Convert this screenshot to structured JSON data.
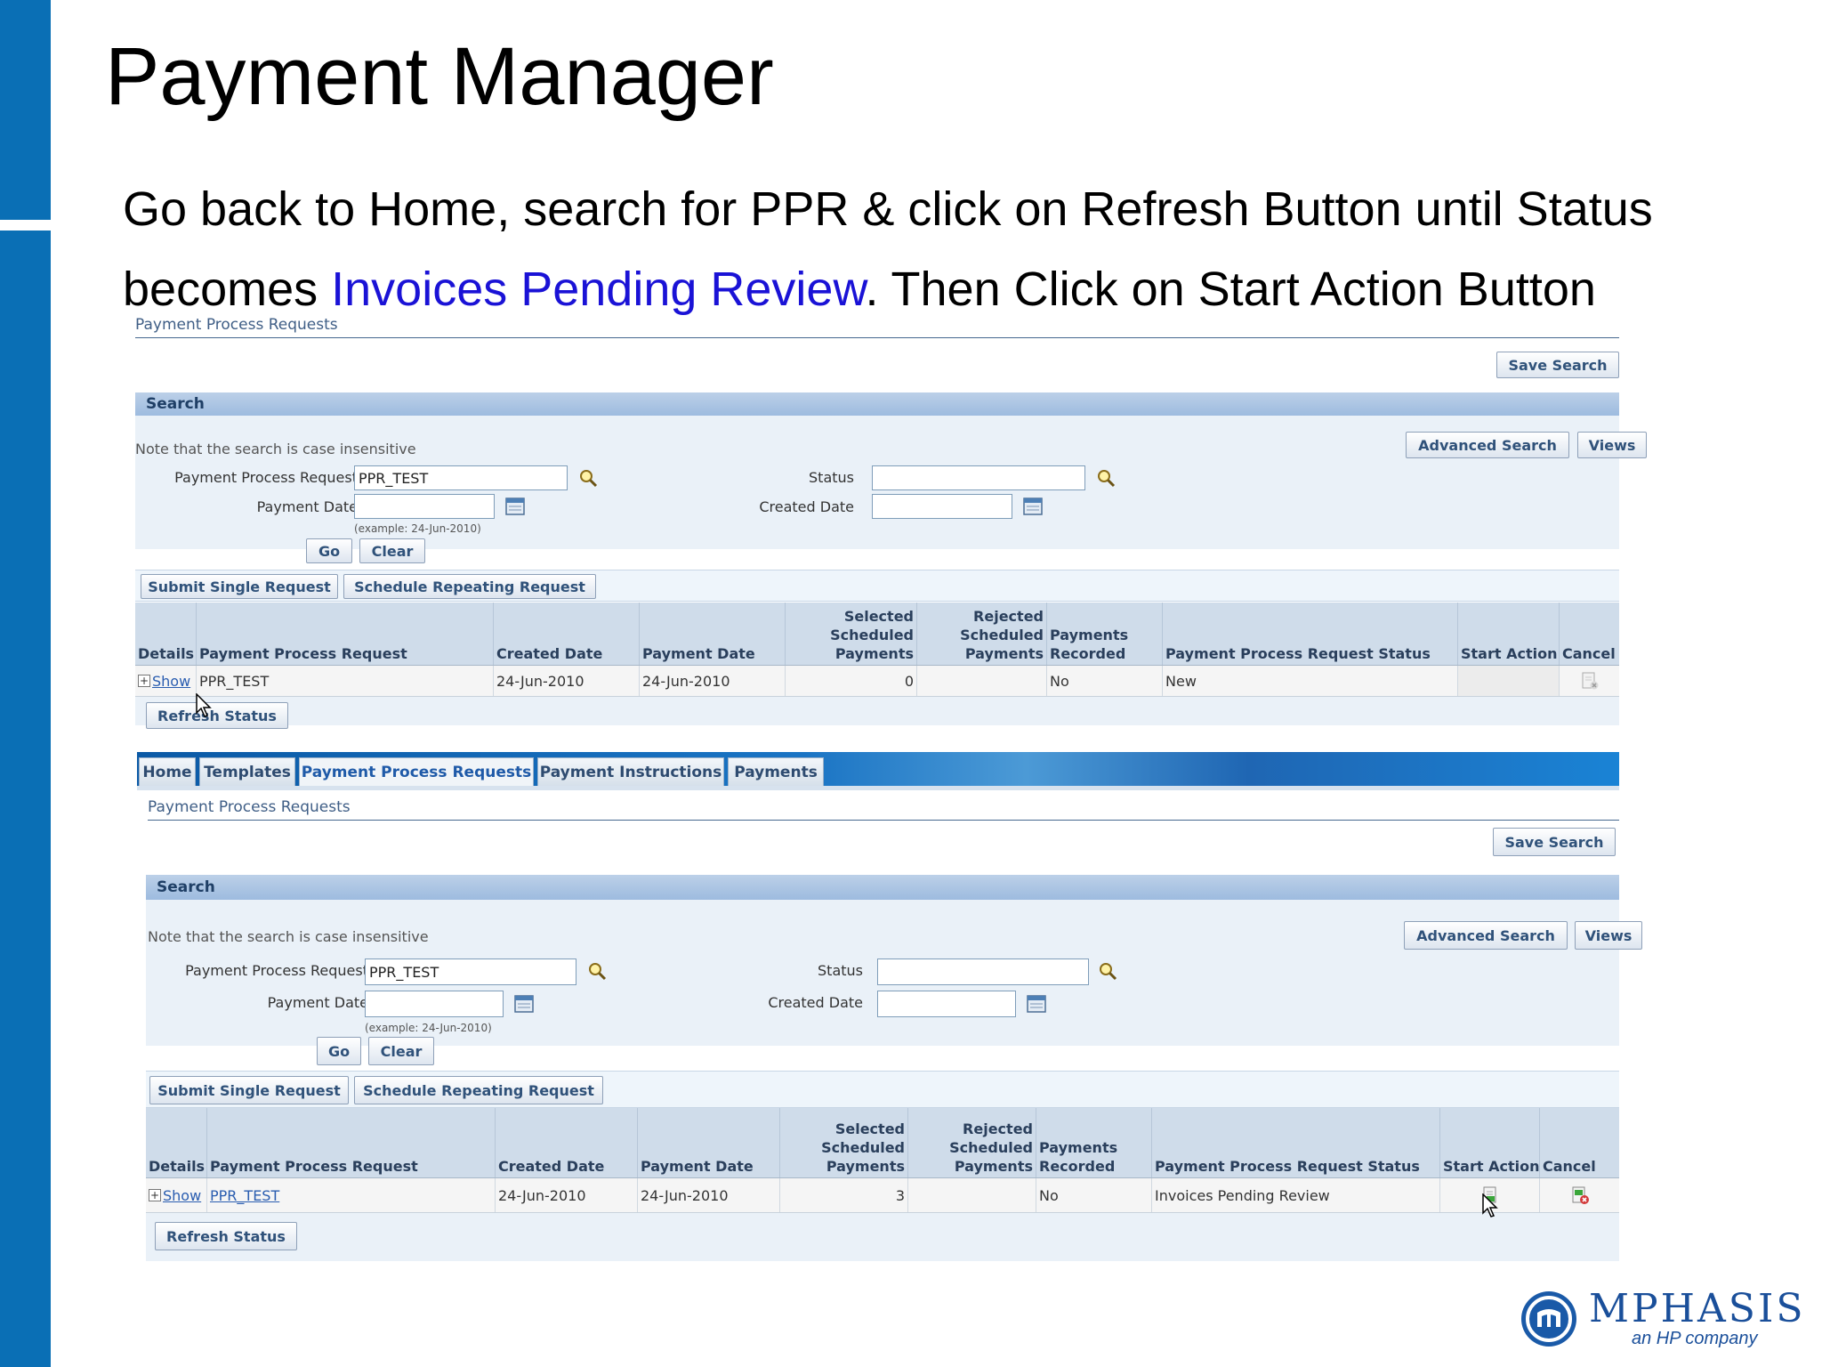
{
  "slide": {
    "title": "Payment Manager",
    "instruction_part1": "Go back to Home, search for PPR & click on Refresh Button until Status becomes ",
    "instruction_highlight": "Invoices Pending Review",
    "instruction_part2": ". Then Click on Start Action Button",
    "highlight_color": "#1a12d6",
    "accent_color": "#0a6fb5"
  },
  "panel1": {
    "page_title": "Payment Process Requests",
    "save_search": "Save Search",
    "search_header": "Search",
    "note": "Note that the search is case insensitive",
    "advanced_search": "Advanced Search",
    "views": "Views",
    "ppr_label": "Payment Process Request",
    "ppr_value": "PPR_TEST",
    "status_label": "Status",
    "status_value": "",
    "payment_date_label": "Payment Date",
    "payment_date_value": "",
    "created_date_label": "Created Date",
    "created_date_value": "",
    "example": "(example: 24-Jun-2010)",
    "go": "Go",
    "clear": "Clear",
    "submit_single": "Submit Single Request",
    "schedule_repeating": "Schedule Repeating Request",
    "columns": {
      "details": "Details",
      "ppr": "Payment Process Request",
      "created": "Created Date",
      "payment": "Payment Date",
      "selected_1": "Selected",
      "selected_2": "Scheduled",
      "selected_3": "Payments",
      "rejected_1": "Rejected",
      "rejected_2": "Scheduled",
      "rejected_3": "Payments",
      "recorded_1": "Payments",
      "recorded_2": "Recorded",
      "status": "Payment Process Request Status",
      "start_action": "Start Action",
      "cancel": "Cancel"
    },
    "row": {
      "details_toggle": "+",
      "show": "Show",
      "ppr": "PPR_TEST",
      "created": "24-Jun-2010",
      "payment": "24-Jun-2010",
      "selected": "0",
      "rejected": "",
      "recorded": "No",
      "status": "New"
    },
    "refresh_status": "Refresh Status"
  },
  "panel2": {
    "tabs": [
      "Home",
      "Templates",
      "Payment Process Requests",
      "Payment Instructions",
      "Payments"
    ],
    "active_tab": "Payment Process Requests",
    "page_title": "Payment Process Requests",
    "save_search": "Save Search",
    "search_header": "Search",
    "note": "Note that the search is case insensitive",
    "advanced_search": "Advanced Search",
    "views": "Views",
    "ppr_label": "Payment Process Request",
    "ppr_value": "PPR_TEST",
    "status_label": "Status",
    "status_value": "",
    "payment_date_label": "Payment Date",
    "payment_date_value": "",
    "created_date_label": "Created Date",
    "created_date_value": "",
    "example": "(example: 24-Jun-2010)",
    "go": "Go",
    "clear": "Clear",
    "submit_single": "Submit Single Request",
    "schedule_repeating": "Schedule Repeating Request",
    "columns": {
      "details": "Details",
      "ppr": "Payment Process Request",
      "created": "Created Date",
      "payment": "Payment Date",
      "selected_1": "Selected",
      "selected_2": "Scheduled",
      "selected_3": "Payments",
      "rejected_1": "Rejected",
      "rejected_2": "Scheduled",
      "rejected_3": "Payments",
      "recorded_1": "Payments",
      "recorded_2": "Recorded",
      "status": "Payment Process Request Status",
      "start_action": "Start Action",
      "cancel": "Cancel"
    },
    "row": {
      "details_toggle": "+",
      "show": "Show",
      "ppr": "PPR_TEST",
      "created": "24-Jun-2010",
      "payment": "24-Jun-2010",
      "selected": "3",
      "rejected": "",
      "recorded": "No",
      "status": "Invoices Pending Review"
    },
    "refresh_status": "Refresh Status"
  },
  "logo": {
    "name": "MPHASIS",
    "tagline": "an HP company"
  }
}
